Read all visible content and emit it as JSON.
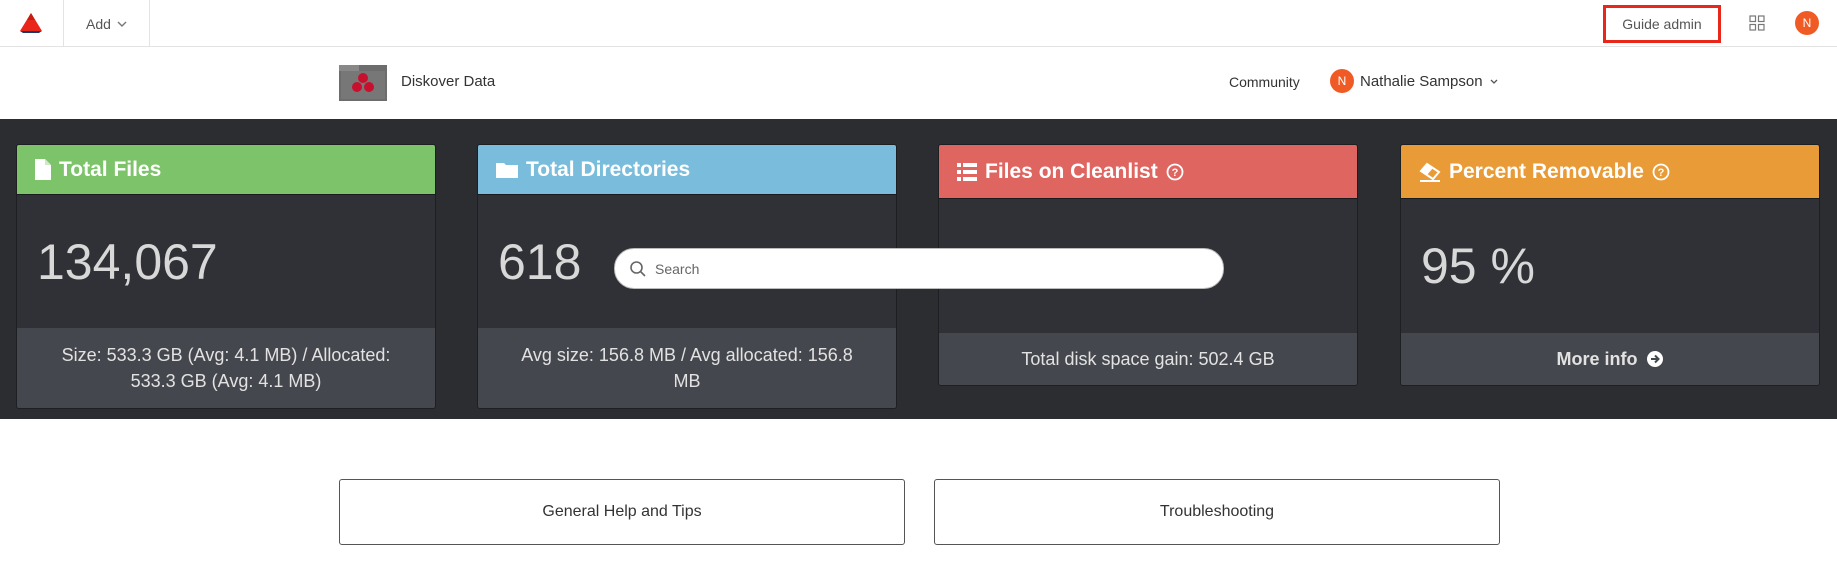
{
  "topbar": {
    "add_label": "Add",
    "guide_admin_label": "Guide admin",
    "avatar_initial": "N"
  },
  "subhead": {
    "brand_name": "Diskover Data",
    "community_label": "Community",
    "user_initial": "N",
    "user_name": "Nathalie Sampson"
  },
  "cards": [
    {
      "title": "Total Files",
      "value": "134,067",
      "footer": "Size: 533.3 GB (Avg: 4.1 MB) / Allocated: 533.3 GB (Avg: 4.1 MB)",
      "color": "#7cc36a"
    },
    {
      "title": "Total Directories",
      "value": "618",
      "footer": "Avg size: 156.8 MB / Avg allocated: 156.8 MB",
      "color": "#79bcdc"
    },
    {
      "title": "Files on Cleanlist",
      "value": "",
      "footer": "Total disk space gain: 502.4 GB",
      "color": "#df6560"
    },
    {
      "title": "Percent Removable",
      "value": "95 %",
      "footer": "More info",
      "color": "#e89b36"
    }
  ],
  "search": {
    "placeholder": "Search"
  },
  "help": {
    "general_label": "General Help and Tips",
    "troubleshooting_label": "Troubleshooting"
  },
  "colors": {
    "accent": "#f05a24",
    "highlight": "#e8271a",
    "band": "#2b2d31"
  }
}
